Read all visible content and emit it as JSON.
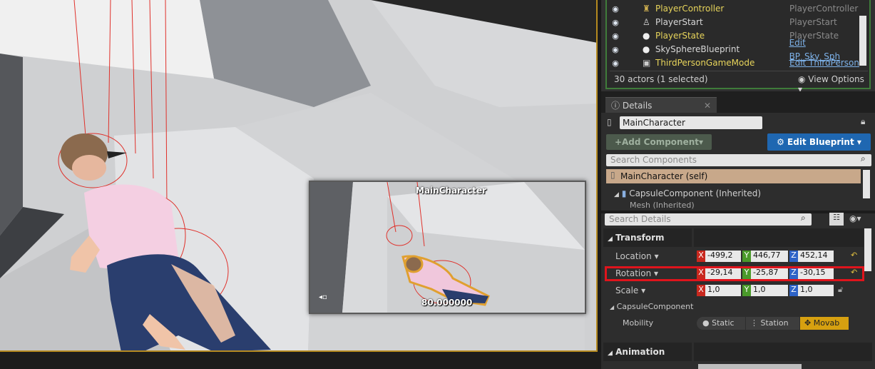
{
  "viewport": {
    "pip_label": "MainCharacter",
    "pip_fov": "80.000000"
  },
  "outliner": {
    "rows": [
      {
        "name": "PlayerController",
        "type": "PlayerController",
        "type_is_link": false,
        "name_color": "#e7d45b",
        "icon": "controller-icon"
      },
      {
        "name": "PlayerStart",
        "type": "PlayerStart",
        "type_is_link": false,
        "name_color": "#d8d8d8",
        "icon": "player-start-icon"
      },
      {
        "name": "PlayerState",
        "type": "PlayerState",
        "type_is_link": false,
        "name_color": "#e7d45b",
        "icon": "sphere-icon"
      },
      {
        "name": "SkySphereBlueprint",
        "type": "Edit BP_Sky_Sph",
        "type_is_link": true,
        "name_color": "#d8d8d8",
        "icon": "sphere-icon"
      },
      {
        "name": "ThirdPersonGameMode",
        "type": "Edit ThirdPerson",
        "type_is_link": true,
        "name_color": "#e7d45b",
        "icon": "gamemode-icon"
      }
    ],
    "status": "30 actors (1 selected)",
    "view_options": "View Options"
  },
  "details": {
    "tab_label": "Details",
    "actor_name": "MainCharacter",
    "add_component": "Add Component",
    "edit_blueprint": "Edit Blueprint",
    "search_components_placeholder": "Search Components",
    "components": {
      "self": "MainCharacter (self)",
      "capsule": "CapsuleComponent (Inherited)",
      "mesh": "Mesh (Inherited)"
    },
    "search_details_placeholder": "Search Details",
    "transform": {
      "header": "Transform",
      "location_label": "Location",
      "rotation_label": "Rotation",
      "scale_label": "Scale",
      "location": {
        "x": "-499,2",
        "y": "446,77",
        "z": "452,14"
      },
      "rotation": {
        "x": "-29,14",
        "y": "-25,87",
        "z": "-30,15"
      },
      "scale": {
        "x": "1,0",
        "y": "1,0",
        "z": "1,0"
      }
    },
    "capsule_section": "CapsuleComponent",
    "mobility": {
      "label": "Mobility",
      "options": [
        "Static",
        "Station",
        "Movab"
      ],
      "selected": "Movab"
    },
    "animation_header": "Animation"
  },
  "colors": {
    "highlight_box": "#e0141c",
    "selection_border": "#b58a20",
    "blueprint_button": "#1f67b1"
  }
}
